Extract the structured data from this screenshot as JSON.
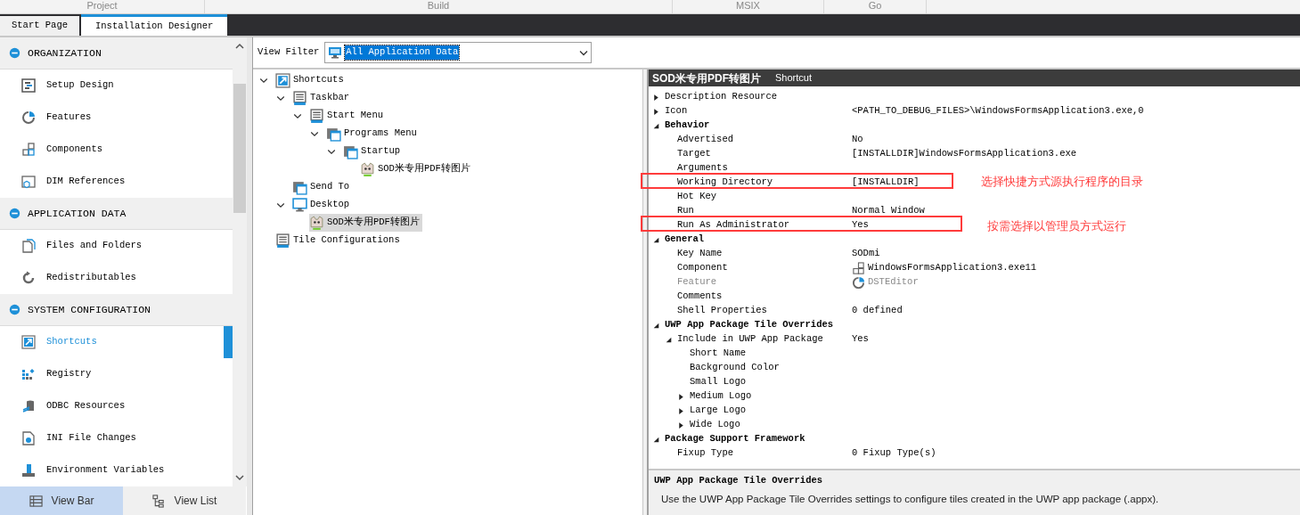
{
  "ribbon_groups": [
    "Project",
    "Build",
    "MSIX",
    "Go"
  ],
  "tabs": [
    {
      "label": "Start Page",
      "selected": false
    },
    {
      "label": "Installation Designer",
      "selected": true
    }
  ],
  "sidebar": {
    "sections": [
      {
        "title": "ORGANIZATION",
        "expanded": true,
        "items": [
          {
            "label": "Setup Design",
            "kind": "setup",
            "selected": false
          },
          {
            "label": "Features",
            "kind": "features",
            "selected": false
          },
          {
            "label": "Components",
            "kind": "components",
            "selected": false
          },
          {
            "label": "DIM References",
            "kind": "dim",
            "selected": false
          }
        ]
      },
      {
        "title": "APPLICATION DATA",
        "expanded": true,
        "items": [
          {
            "label": "Files and Folders",
            "kind": "files",
            "selected": false
          },
          {
            "label": "Redistributables",
            "kind": "redist",
            "selected": false
          }
        ]
      },
      {
        "title": "SYSTEM CONFIGURATION",
        "expanded": true,
        "items": [
          {
            "label": "Shortcuts",
            "kind": "shortcut",
            "selected": true
          },
          {
            "label": "Registry",
            "kind": "registry",
            "selected": false
          },
          {
            "label": "ODBC Resources",
            "kind": "odbc",
            "selected": false
          },
          {
            "label": "INI File Changes",
            "kind": "ini",
            "selected": false
          },
          {
            "label": "Environment Variables",
            "kind": "env",
            "selected": false
          }
        ]
      }
    ],
    "bottom_buttons": [
      {
        "label": "View Bar",
        "kind": "bar",
        "selected": true
      },
      {
        "label": "View List",
        "kind": "list",
        "selected": false
      }
    ]
  },
  "view_filter": {
    "label": "View Filter",
    "value": "All Application Data"
  },
  "tree": [
    {
      "label": "Shortcuts",
      "kind": "shortcut",
      "expanded": true,
      "selected": false,
      "children": [
        {
          "label": "Taskbar",
          "kind": "list",
          "expanded": true,
          "selected": false,
          "children": [
            {
              "label": "Start Menu",
              "kind": "list",
              "expanded": true,
              "selected": false,
              "children": [
                {
                  "label": "Programs Menu",
                  "kind": "folder",
                  "expanded": true,
                  "selected": false,
                  "children": [
                    {
                      "label": "Startup",
                      "kind": "folder",
                      "expanded": true,
                      "selected": false,
                      "children": [
                        {
                          "label": "SOD米专用PDF转图片",
                          "kind": "app",
                          "selected": false
                        }
                      ]
                    }
                  ]
                }
              ]
            }
          ]
        },
        {
          "label": "Send To",
          "kind": "folder",
          "selected": false
        },
        {
          "label": "Desktop",
          "kind": "desktop",
          "expanded": true,
          "selected": false,
          "children": [
            {
              "label": "SOD米专用PDF转图片",
              "kind": "app",
              "selected": true
            }
          ]
        }
      ]
    },
    {
      "label": "Tile Configurations",
      "kind": "list",
      "selected": false
    }
  ],
  "properties": {
    "title": "SOD米专用PDF转图片",
    "subtitle": "Shortcut",
    "rows": [
      {
        "kind": "property",
        "name": "Description Resource",
        "expanded": false,
        "disabled": false
      },
      {
        "kind": "property",
        "name": "Icon",
        "value": "<PATH_TO_DEBUG_FILES>\\WindowsFormsApplication3.exe,0",
        "expanded": false,
        "disabled": false
      },
      {
        "kind": "category",
        "name": "Behavior",
        "expanded": true,
        "children": [
          {
            "kind": "property",
            "name": "Advertised",
            "value": "No",
            "disabled": false
          },
          {
            "kind": "property",
            "name": "Target",
            "value": "[INSTALLDIR]WindowsFormsApplication3.exe",
            "disabled": false
          },
          {
            "kind": "property",
            "name": "Arguments",
            "disabled": false
          },
          {
            "kind": "property",
            "name": "Working Directory",
            "value": "[INSTALLDIR]",
            "disabled": false
          },
          {
            "kind": "property",
            "name": "Hot Key",
            "disabled": false
          },
          {
            "kind": "property",
            "name": "Run",
            "value": "Normal Window",
            "disabled": false
          },
          {
            "kind": "property",
            "name": "Run As Administrator",
            "value": "Yes",
            "disabled": false
          }
        ]
      },
      {
        "kind": "category",
        "name": "General",
        "expanded": true,
        "children": [
          {
            "kind": "property",
            "name": "Key Name",
            "value": "SODmi",
            "disabled": false
          },
          {
            "kind": "component",
            "name": "Component",
            "value": "WindowsFormsApplication3.exe11",
            "disabled": false
          },
          {
            "kind": "feature",
            "name": "Feature",
            "value": "DSTEditor",
            "disabled": true
          },
          {
            "kind": "property",
            "name": "Comments",
            "disabled": false
          },
          {
            "kind": "property",
            "name": "Shell Properties",
            "value": "0 defined",
            "disabled": false
          }
        ]
      },
      {
        "kind": "category",
        "name": "UWP App Package Tile Overrides",
        "expanded": true,
        "children": [
          {
            "kind": "property",
            "name": "Include in UWP App Package",
            "value": "Yes",
            "expanded": true,
            "disabled": false,
            "children": [
              {
                "kind": "property",
                "name": "Short Name",
                "disabled": false
              },
              {
                "kind": "property",
                "name": "Background Color",
                "disabled": false
              },
              {
                "kind": "property",
                "name": "Small Logo",
                "disabled": false
              },
              {
                "kind": "property",
                "name": "Medium Logo",
                "expanded": false,
                "disabled": false
              },
              {
                "kind": "property",
                "name": "Large Logo",
                "expanded": false,
                "disabled": false
              },
              {
                "kind": "property",
                "name": "Wide Logo",
                "expanded": false,
                "disabled": false
              }
            ]
          }
        ]
      },
      {
        "kind": "category",
        "name": "Package Support Framework",
        "expanded": true,
        "children": [
          {
            "kind": "property",
            "name": "Fixup Type",
            "value": "0 Fixup Type(s)",
            "disabled": false
          }
        ]
      }
    ],
    "description": {
      "title": "UWP App Package Tile Overrides",
      "text": "Use the UWP App Package Tile Overrides settings to configure tiles created in the UWP app package (.appx)."
    }
  },
  "annotations": [
    {
      "text": "选择快捷方式源执行程序的目录"
    },
    {
      "text": "按需选择以管理员方式运行"
    }
  ]
}
